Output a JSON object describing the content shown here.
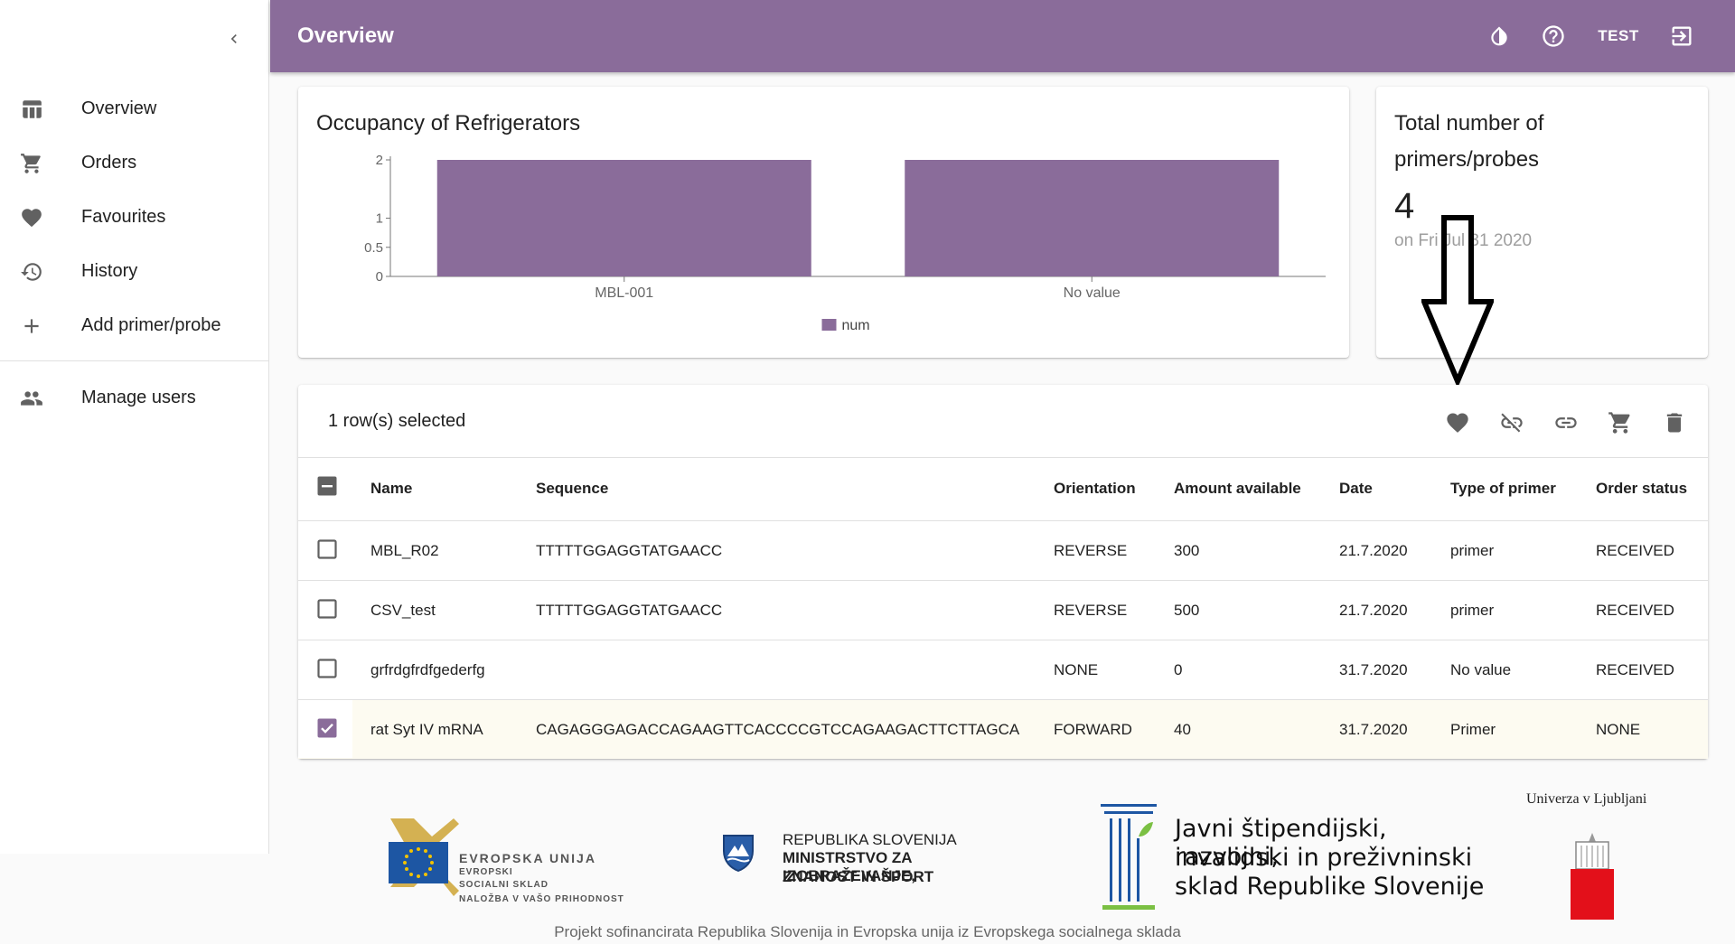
{
  "app": {
    "title": "Overview",
    "user_label": "TEST"
  },
  "sidebar": {
    "items": [
      {
        "label": "Overview",
        "icon": "table-icon"
      },
      {
        "label": "Orders",
        "icon": "cart-icon"
      },
      {
        "label": "Favourites",
        "icon": "heart-icon"
      },
      {
        "label": "History",
        "icon": "history-icon"
      },
      {
        "label": "Add primer/probe",
        "icon": "plus-icon"
      },
      {
        "label": "Manage users",
        "icon": "people-icon"
      }
    ]
  },
  "occupancy_card": {
    "title": "Occupancy of Refrigerators"
  },
  "chart_data": {
    "type": "bar",
    "title": "Occupancy of Refrigerators",
    "categories": [
      "MBL-001",
      "No value"
    ],
    "series": [
      {
        "name": "num",
        "values": [
          2,
          2
        ]
      }
    ],
    "ylim": [
      0,
      2
    ],
    "yticks": [
      "0",
      "0.5",
      "1",
      "2"
    ],
    "ytick_values": [
      0,
      0.5,
      1,
      2
    ],
    "xlabel": "",
    "ylabel": "",
    "legend": "bottom-center",
    "color": "#8a6c9a"
  },
  "total_card": {
    "title_line1": "Total number of",
    "title_line2": "primers/probes",
    "count": "4",
    "date": "on Fri Jul 31 2020"
  },
  "table": {
    "selected_text": "1 row(s) selected",
    "columns": [
      "Name",
      "Sequence",
      "Orientation",
      "Amount available",
      "Date",
      "Type of primer",
      "Order status"
    ],
    "rows": [
      {
        "name": "MBL_R02",
        "sequence": "TTTTTGGAGGTATGAACC",
        "orientation": "REVERSE",
        "amount": "300",
        "date": "21.7.2020",
        "type": "primer",
        "status": "RECEIVED",
        "checked": false
      },
      {
        "name": "CSV_test",
        "sequence": "TTTTTGGAGGTATGAACC",
        "orientation": "REVERSE",
        "amount": "500",
        "date": "21.7.2020",
        "type": "primer",
        "status": "RECEIVED",
        "checked": false
      },
      {
        "name": "grfrdgfrdfgederfg",
        "sequence": "",
        "orientation": "NONE",
        "amount": "0",
        "date": "31.7.2020",
        "type": "No value",
        "status": "RECEIVED",
        "checked": false
      },
      {
        "name": "rat Syt IV mRNA",
        "sequence": "CAGAGGGAGACCAGAAGTTCACCCCGTCCAGAAGACTTCTTAGCA",
        "orientation": "FORWARD",
        "amount": "40",
        "date": "31.7.2020",
        "type": "Primer",
        "status": "NONE",
        "checked": true
      }
    ]
  },
  "footer": {
    "eu_logo": [
      "EVROPSKA UNIJA",
      "EVROPSKI",
      "SOCIALNI SKLAD",
      "NALOŽBA V VAŠO PRIHODNOST"
    ],
    "ministry_logo": [
      "REPUBLIKA SLOVENIJA",
      "MINISTRSTVO ZA IZOBRAŽEVANJE,",
      "ZNANOST IN ŠPORT"
    ],
    "fund_logo": [
      "Javni štipendijski, razvojni,",
      "invalidski in preživninski",
      "sklad Republike Slovenije"
    ],
    "uni_logo": "Univerza v Ljubljani",
    "note": "Projekt sofinancirata Republika Slovenija in Evropska unija iz Evropskega socialnega sklada"
  },
  "colors": {
    "primary": "#8a6c9a",
    "icon": "#616161",
    "selected_row": "#fdfbf1"
  }
}
